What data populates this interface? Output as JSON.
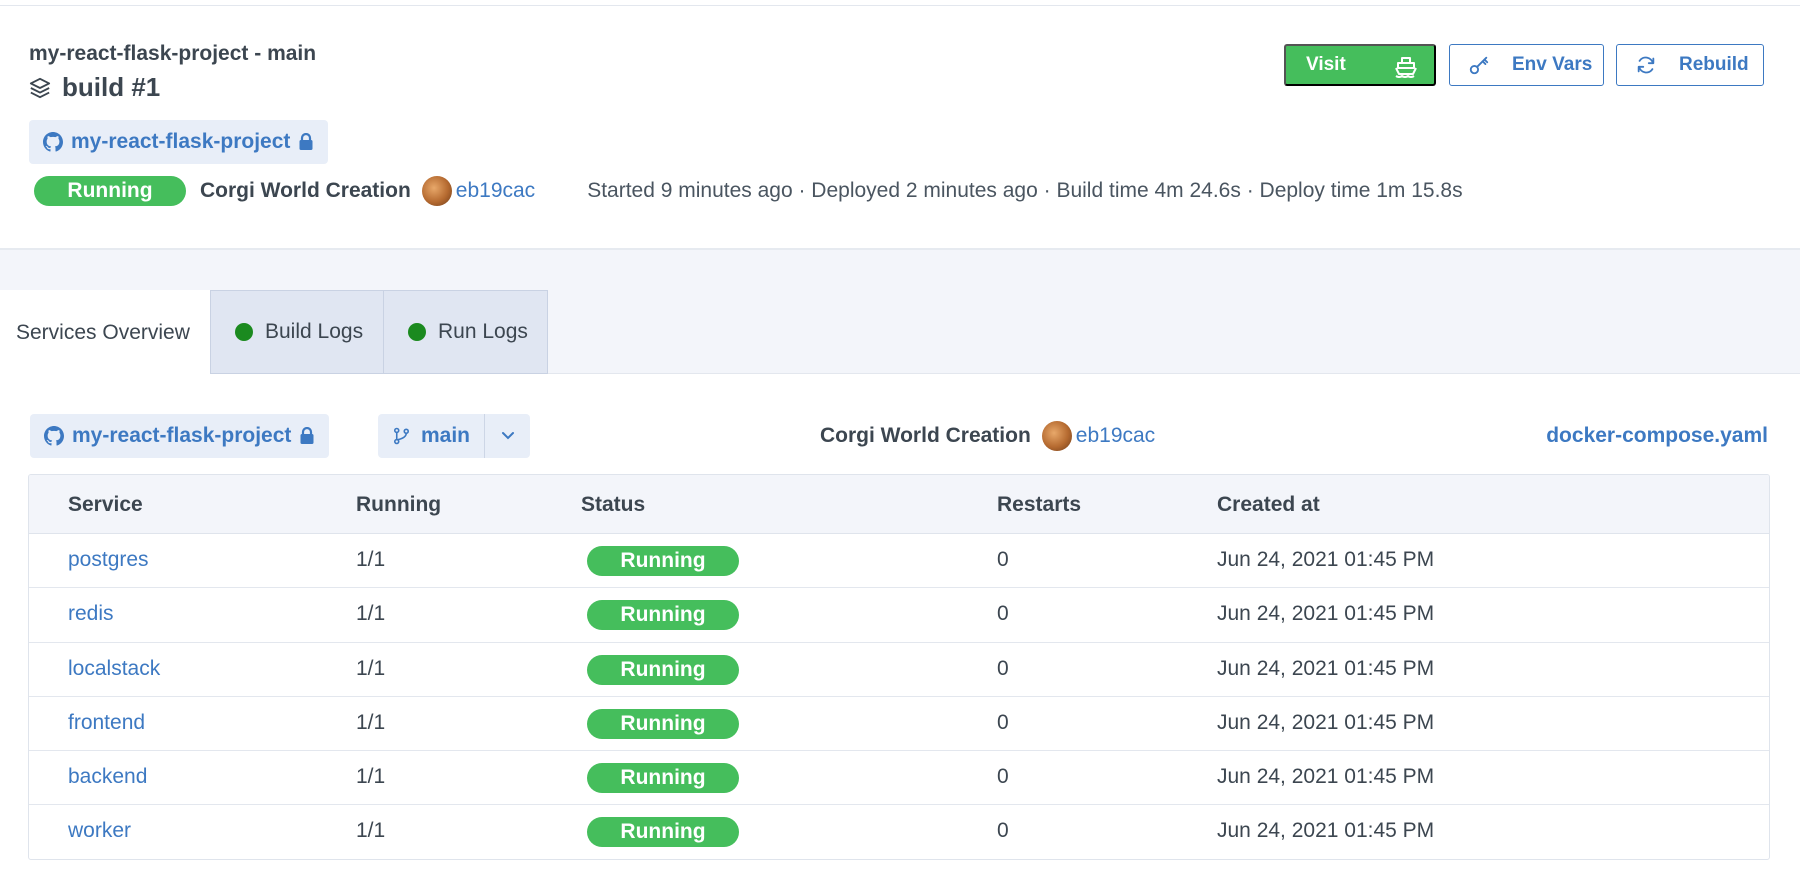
{
  "header": {
    "project_branch": "my-react-flask-project - main",
    "build_title": "build #1",
    "repo": "my-react-flask-project",
    "status": "Running",
    "commit_message": "Corgi World Creation",
    "commit_hash": "eb19cac",
    "meta": "Started 9 minutes ago · Deployed 2 minutes ago · Build time  4m 24.6s · Deploy time  1m 15.8s"
  },
  "actions": {
    "visit": "Visit",
    "env_vars": "Env Vars",
    "rebuild": "Rebuild"
  },
  "tabs": [
    {
      "label": "Services Overview"
    },
    {
      "label": "Build Logs"
    },
    {
      "label": "Run Logs"
    }
  ],
  "overview": {
    "repo": "my-react-flask-project",
    "branch": "main",
    "commit_message": "Corgi World Creation",
    "commit_hash": "eb19cac",
    "compose_file": "docker-compose.yaml"
  },
  "table": {
    "columns": [
      "Service",
      "Running",
      "Status",
      "Restarts",
      "Created at"
    ],
    "rows": [
      {
        "service": "postgres",
        "running": "1/1",
        "status": "Running",
        "restarts": "0",
        "created": "Jun 24, 2021 01:45 PM"
      },
      {
        "service": "redis",
        "running": "1/1",
        "status": "Running",
        "restarts": "0",
        "created": "Jun 24, 2021 01:45 PM"
      },
      {
        "service": "localstack",
        "running": "1/1",
        "status": "Running",
        "restarts": "0",
        "created": "Jun 24, 2021 01:45 PM"
      },
      {
        "service": "frontend",
        "running": "1/1",
        "status": "Running",
        "restarts": "0",
        "created": "Jun 24, 2021 01:45 PM"
      },
      {
        "service": "backend",
        "running": "1/1",
        "status": "Running",
        "restarts": "0",
        "created": "Jun 24, 2021 01:45 PM"
      },
      {
        "service": "worker",
        "running": "1/1",
        "status": "Running",
        "restarts": "0",
        "created": "Jun 24, 2021 01:45 PM"
      }
    ]
  },
  "colors": {
    "accent": "#3d79c2",
    "success": "#45be5c",
    "tab_dot": "#1b8a1f"
  },
  "icons": {
    "build": "layers-icon",
    "repo": "github-icon",
    "private": "lock-icon",
    "visit": "ship-icon",
    "env": "key-icon",
    "rebuild": "refresh-icon",
    "branch": "git-branch-icon",
    "dropdown": "chevron-down-icon"
  }
}
